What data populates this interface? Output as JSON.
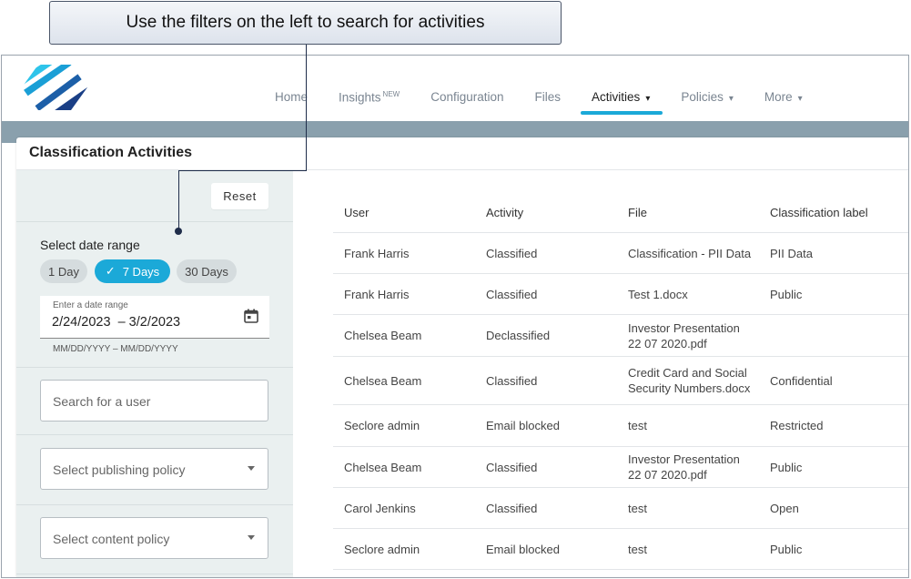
{
  "callout": {
    "text": "Use the filters on the left to search for activities"
  },
  "nav": {
    "items": [
      {
        "label": "Home",
        "badge": "",
        "dropdown": false,
        "active": false
      },
      {
        "label": "Insights",
        "badge": "NEW",
        "dropdown": false,
        "active": false
      },
      {
        "label": "Configuration",
        "badge": "",
        "dropdown": false,
        "active": false
      },
      {
        "label": "Files",
        "badge": "",
        "dropdown": false,
        "active": false
      },
      {
        "label": "Activities",
        "badge": "",
        "dropdown": true,
        "active": true
      },
      {
        "label": "Policies",
        "badge": "",
        "dropdown": true,
        "active": false
      },
      {
        "label": "More",
        "badge": "",
        "dropdown": true,
        "active": false
      }
    ],
    "chevron": "▾"
  },
  "page": {
    "title": "Classification Activities"
  },
  "filters": {
    "reset_label": "Reset",
    "date_range_label": "Select date range",
    "chips": [
      {
        "label": "1 Day",
        "selected": false
      },
      {
        "label": "7 Days",
        "selected": true,
        "check": "✓"
      },
      {
        "label": "30 Days",
        "selected": false
      }
    ],
    "range_field": {
      "label": "Enter a date range",
      "value": "2/24/2023  – 3/2/2023",
      "hint": "MM/DD/YYYY – MM/DD/YYYY",
      "icon": "calendar-icon"
    },
    "user_search_placeholder": "Search for a user",
    "publishing_policy_placeholder": "Select publishing policy",
    "content_policy_placeholder": "Select content policy"
  },
  "table": {
    "columns": [
      "User",
      "Activity",
      "File",
      "Classification label"
    ],
    "rows": [
      {
        "user": "Frank Harris",
        "activity": "Classified",
        "file": "Classification - PII Data",
        "label": "PII Data"
      },
      {
        "user": "Frank Harris",
        "activity": "Classified",
        "file": "Test 1.docx",
        "label": "Public"
      },
      {
        "user": "Chelsea Beam",
        "activity": "Declassified",
        "file": "Investor Presentation 22 07 2020.pdf",
        "label": ""
      },
      {
        "user": "Chelsea Beam",
        "activity": "Classified",
        "file": "Credit Card and Social Security Numbers.docx",
        "label": "Confidential"
      },
      {
        "user": "Seclore admin",
        "activity": "Email blocked",
        "file": "test",
        "label": "Restricted"
      },
      {
        "user": "Chelsea Beam",
        "activity": "Classified",
        "file": "Investor Presentation 22 07 2020.pdf",
        "label": "Public"
      },
      {
        "user": "Carol Jenkins",
        "activity": "Classified",
        "file": "test",
        "label": "Open"
      },
      {
        "user": "Seclore admin",
        "activity": "Email blocked",
        "file": "test",
        "label": "Public"
      }
    ]
  },
  "colors": {
    "accent": "#1ba9d8",
    "band": "#8aa0ad",
    "panel": "#eaf0f0"
  }
}
